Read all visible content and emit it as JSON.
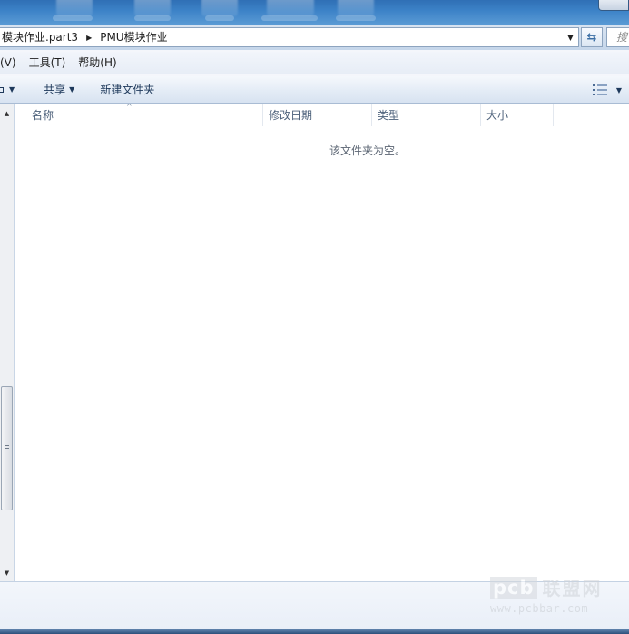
{
  "address_bar": {
    "crumbs": [
      "模块作业.part3",
      "PMU模块作业"
    ],
    "search_placeholder": "搜"
  },
  "menu": {
    "items": [
      "(V)",
      "工具(T)",
      "帮助(H)"
    ]
  },
  "toolbar": {
    "share_label": "共享",
    "new_folder_label": "新建文件夹"
  },
  "file_list": {
    "columns": [
      "名称",
      "修改日期",
      "类型",
      "大小"
    ],
    "empty_message": "该文件夹为空。"
  },
  "watermark": {
    "mark": "pcb",
    "name": "联盟网",
    "url": "www.pcbbar.com"
  }
}
